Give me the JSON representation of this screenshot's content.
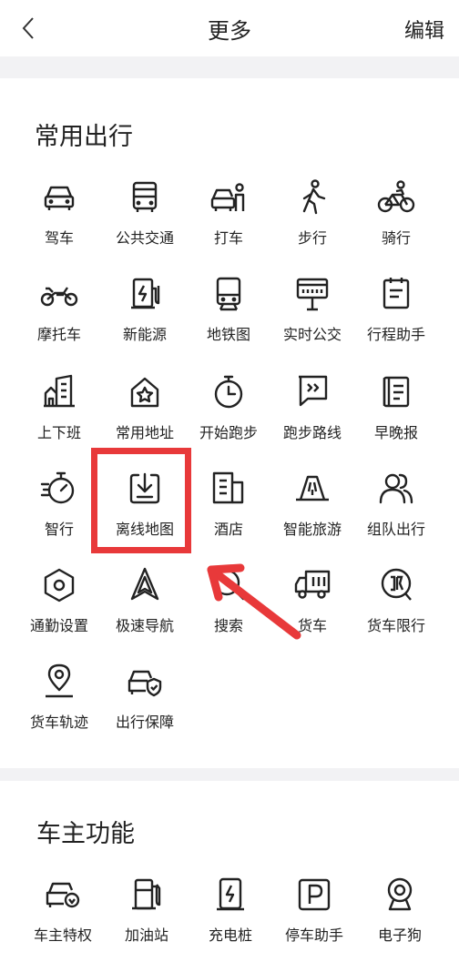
{
  "header": {
    "back_icon": "chevron-left-icon",
    "title": "更多",
    "edit_label": "编辑"
  },
  "sections": [
    {
      "title": "常用出行",
      "items": [
        {
          "label": "驾车",
          "icon": "car-icon"
        },
        {
          "label": "公共交通",
          "icon": "bus-icon"
        },
        {
          "label": "打车",
          "icon": "taxi-icon"
        },
        {
          "label": "步行",
          "icon": "walk-icon"
        },
        {
          "label": "骑行",
          "icon": "bicycle-icon"
        },
        {
          "label": "摩托车",
          "icon": "motorcycle-icon"
        },
        {
          "label": "新能源",
          "icon": "charging-station-icon"
        },
        {
          "label": "地铁图",
          "icon": "subway-icon"
        },
        {
          "label": "实时公交",
          "icon": "bus-stop-sign-icon"
        },
        {
          "label": "行程助手",
          "icon": "clipboard-icon"
        },
        {
          "label": "上下班",
          "icon": "office-building-icon"
        },
        {
          "label": "常用地址",
          "icon": "home-star-icon"
        },
        {
          "label": "开始跑步",
          "icon": "stopwatch-icon"
        },
        {
          "label": "跑步路线",
          "icon": "route-flag-icon"
        },
        {
          "label": "早晚报",
          "icon": "newspaper-icon"
        },
        {
          "label": "智行",
          "icon": "speed-timer-icon"
        },
        {
          "label": "离线地图",
          "icon": "download-icon"
        },
        {
          "label": "酒店",
          "icon": "hotel-icon"
        },
        {
          "label": "智能旅游",
          "icon": "mountain-icon"
        },
        {
          "label": "组队出行",
          "icon": "group-icon"
        },
        {
          "label": "通勤设置",
          "icon": "hexagon-settings-icon"
        },
        {
          "label": "极速导航",
          "icon": "navigation-arrow-icon"
        },
        {
          "label": "搜索",
          "icon": "search-icon"
        },
        {
          "label": "货车",
          "icon": "truck-icon"
        },
        {
          "label": "货车限行",
          "icon": "restriction-sign-icon"
        },
        {
          "label": "货车轨迹",
          "icon": "location-pin-icon"
        },
        {
          "label": "出行保障",
          "icon": "car-shield-icon"
        }
      ]
    },
    {
      "title": "车主功能",
      "items": [
        {
          "label": "车主特权",
          "icon": "car-badge-icon"
        },
        {
          "label": "加油站",
          "icon": "fuel-pump-icon"
        },
        {
          "label": "充电桩",
          "icon": "charger-icon"
        },
        {
          "label": "停车助手",
          "icon": "parking-icon"
        },
        {
          "label": "电子狗",
          "icon": "camera-icon"
        }
      ]
    }
  ],
  "annotation": {
    "highlight_color": "#e8393a",
    "highlighted_item": "离线地图"
  }
}
